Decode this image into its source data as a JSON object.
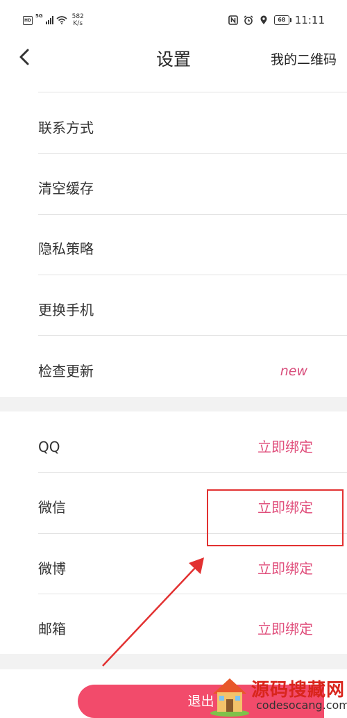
{
  "status_bar": {
    "hd": "HD",
    "network": "5G",
    "speed_value": "582",
    "speed_unit": "K/s",
    "battery": "68",
    "time": "11:11"
  },
  "header": {
    "title": "设置",
    "right_link": "我的二维码"
  },
  "general_items": [
    {
      "label": "联系方式"
    },
    {
      "label": "清空缓存"
    },
    {
      "label": "隐私策略"
    },
    {
      "label": "更换手机"
    },
    {
      "label": "检查更新",
      "badge": "new"
    }
  ],
  "binding_items": [
    {
      "label": "QQ",
      "action": "立即绑定"
    },
    {
      "label": "微信",
      "action": "立即绑定"
    },
    {
      "label": "微博",
      "action": "立即绑定"
    },
    {
      "label": "邮箱",
      "action": "立即绑定"
    }
  ],
  "logout_label": "退出",
  "watermark": {
    "title": "源码搜藏网",
    "url": "codesocang.com"
  },
  "colors": {
    "accent": "#e04f7c",
    "logout_bg": "#f24b6b",
    "annotation": "#e23131"
  }
}
